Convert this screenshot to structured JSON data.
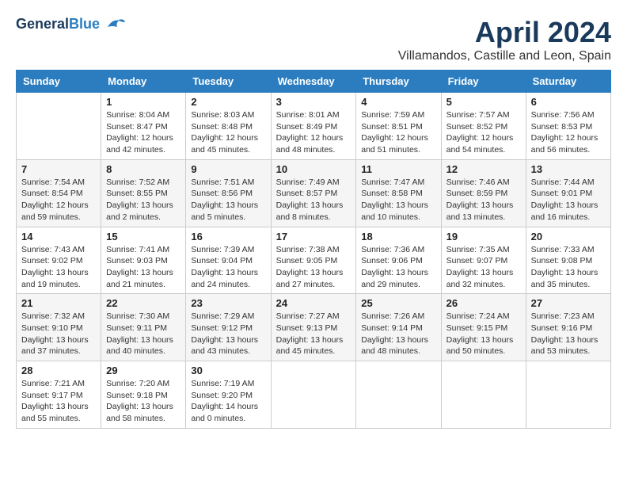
{
  "header": {
    "logo_line1": "General",
    "logo_line2": "Blue",
    "month_title": "April 2024",
    "subtitle": "Villamandos, Castille and Leon, Spain"
  },
  "days_of_week": [
    "Sunday",
    "Monday",
    "Tuesday",
    "Wednesday",
    "Thursday",
    "Friday",
    "Saturday"
  ],
  "weeks": [
    [
      {
        "day": "",
        "info": ""
      },
      {
        "day": "1",
        "info": "Sunrise: 8:04 AM\nSunset: 8:47 PM\nDaylight: 12 hours\nand 42 minutes."
      },
      {
        "day": "2",
        "info": "Sunrise: 8:03 AM\nSunset: 8:48 PM\nDaylight: 12 hours\nand 45 minutes."
      },
      {
        "day": "3",
        "info": "Sunrise: 8:01 AM\nSunset: 8:49 PM\nDaylight: 12 hours\nand 48 minutes."
      },
      {
        "day": "4",
        "info": "Sunrise: 7:59 AM\nSunset: 8:51 PM\nDaylight: 12 hours\nand 51 minutes."
      },
      {
        "day": "5",
        "info": "Sunrise: 7:57 AM\nSunset: 8:52 PM\nDaylight: 12 hours\nand 54 minutes."
      },
      {
        "day": "6",
        "info": "Sunrise: 7:56 AM\nSunset: 8:53 PM\nDaylight: 12 hours\nand 56 minutes."
      }
    ],
    [
      {
        "day": "7",
        "info": "Sunrise: 7:54 AM\nSunset: 8:54 PM\nDaylight: 12 hours\nand 59 minutes."
      },
      {
        "day": "8",
        "info": "Sunrise: 7:52 AM\nSunset: 8:55 PM\nDaylight: 13 hours\nand 2 minutes."
      },
      {
        "day": "9",
        "info": "Sunrise: 7:51 AM\nSunset: 8:56 PM\nDaylight: 13 hours\nand 5 minutes."
      },
      {
        "day": "10",
        "info": "Sunrise: 7:49 AM\nSunset: 8:57 PM\nDaylight: 13 hours\nand 8 minutes."
      },
      {
        "day": "11",
        "info": "Sunrise: 7:47 AM\nSunset: 8:58 PM\nDaylight: 13 hours\nand 10 minutes."
      },
      {
        "day": "12",
        "info": "Sunrise: 7:46 AM\nSunset: 8:59 PM\nDaylight: 13 hours\nand 13 minutes."
      },
      {
        "day": "13",
        "info": "Sunrise: 7:44 AM\nSunset: 9:01 PM\nDaylight: 13 hours\nand 16 minutes."
      }
    ],
    [
      {
        "day": "14",
        "info": "Sunrise: 7:43 AM\nSunset: 9:02 PM\nDaylight: 13 hours\nand 19 minutes."
      },
      {
        "day": "15",
        "info": "Sunrise: 7:41 AM\nSunset: 9:03 PM\nDaylight: 13 hours\nand 21 minutes."
      },
      {
        "day": "16",
        "info": "Sunrise: 7:39 AM\nSunset: 9:04 PM\nDaylight: 13 hours\nand 24 minutes."
      },
      {
        "day": "17",
        "info": "Sunrise: 7:38 AM\nSunset: 9:05 PM\nDaylight: 13 hours\nand 27 minutes."
      },
      {
        "day": "18",
        "info": "Sunrise: 7:36 AM\nSunset: 9:06 PM\nDaylight: 13 hours\nand 29 minutes."
      },
      {
        "day": "19",
        "info": "Sunrise: 7:35 AM\nSunset: 9:07 PM\nDaylight: 13 hours\nand 32 minutes."
      },
      {
        "day": "20",
        "info": "Sunrise: 7:33 AM\nSunset: 9:08 PM\nDaylight: 13 hours\nand 35 minutes."
      }
    ],
    [
      {
        "day": "21",
        "info": "Sunrise: 7:32 AM\nSunset: 9:10 PM\nDaylight: 13 hours\nand 37 minutes."
      },
      {
        "day": "22",
        "info": "Sunrise: 7:30 AM\nSunset: 9:11 PM\nDaylight: 13 hours\nand 40 minutes."
      },
      {
        "day": "23",
        "info": "Sunrise: 7:29 AM\nSunset: 9:12 PM\nDaylight: 13 hours\nand 43 minutes."
      },
      {
        "day": "24",
        "info": "Sunrise: 7:27 AM\nSunset: 9:13 PM\nDaylight: 13 hours\nand 45 minutes."
      },
      {
        "day": "25",
        "info": "Sunrise: 7:26 AM\nSunset: 9:14 PM\nDaylight: 13 hours\nand 48 minutes."
      },
      {
        "day": "26",
        "info": "Sunrise: 7:24 AM\nSunset: 9:15 PM\nDaylight: 13 hours\nand 50 minutes."
      },
      {
        "day": "27",
        "info": "Sunrise: 7:23 AM\nSunset: 9:16 PM\nDaylight: 13 hours\nand 53 minutes."
      }
    ],
    [
      {
        "day": "28",
        "info": "Sunrise: 7:21 AM\nSunset: 9:17 PM\nDaylight: 13 hours\nand 55 minutes."
      },
      {
        "day": "29",
        "info": "Sunrise: 7:20 AM\nSunset: 9:18 PM\nDaylight: 13 hours\nand 58 minutes."
      },
      {
        "day": "30",
        "info": "Sunrise: 7:19 AM\nSunset: 9:20 PM\nDaylight: 14 hours\nand 0 minutes."
      },
      {
        "day": "",
        "info": ""
      },
      {
        "day": "",
        "info": ""
      },
      {
        "day": "",
        "info": ""
      },
      {
        "day": "",
        "info": ""
      }
    ]
  ]
}
